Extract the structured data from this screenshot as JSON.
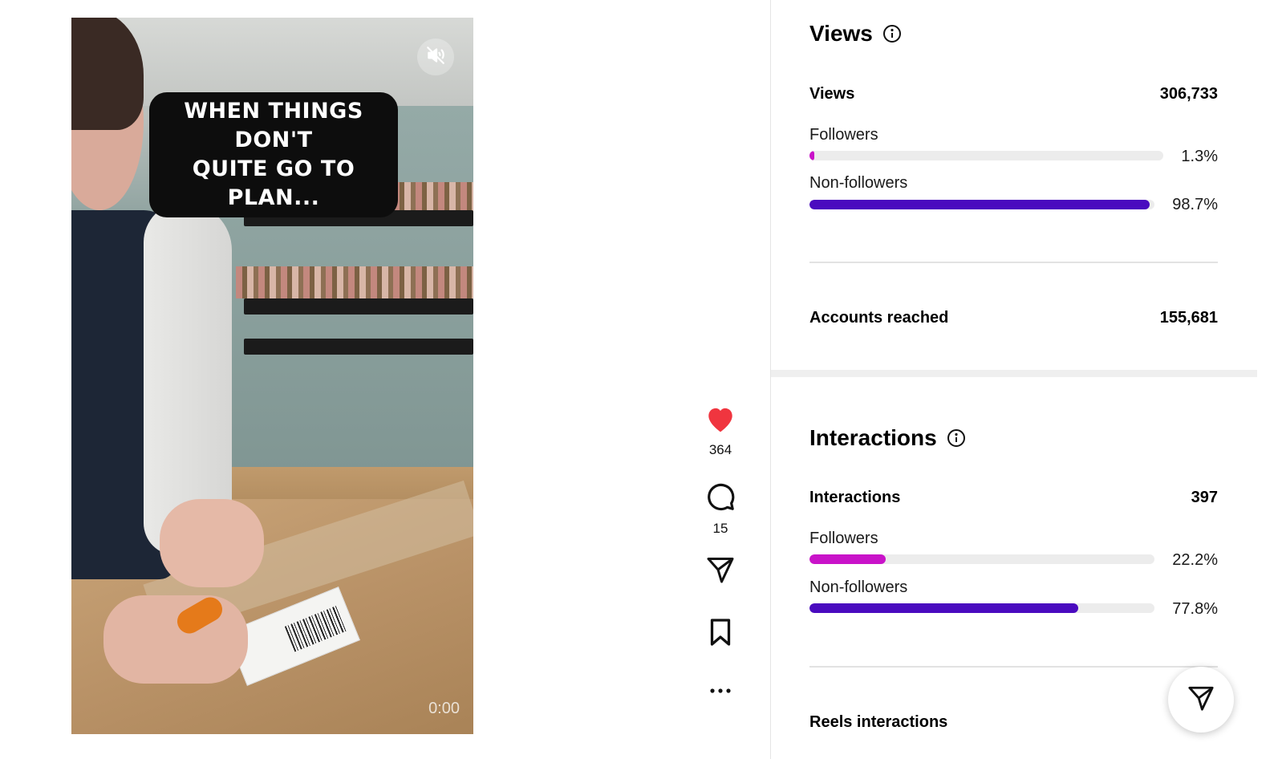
{
  "video": {
    "caption": "WHEN THINGS DON'T\nQUITE GO TO PLAN...",
    "time": "0:00",
    "mute_icon": "speaker-muted-icon"
  },
  "actions": {
    "like_count": "364",
    "comment_count": "15",
    "like_color": "#f0353f"
  },
  "views_section": {
    "title": "Views",
    "total_label": "Views",
    "total_value": "306,733",
    "followers_label": "Followers",
    "followers_pct": "1.3%",
    "followers_fraction": 0.013,
    "nonfollowers_label": "Non-followers",
    "nonfollowers_pct": "98.7%",
    "nonfollowers_fraction": 0.987,
    "accounts_reached_label": "Accounts reached",
    "accounts_reached_value": "155,681"
  },
  "interactions_section": {
    "title": "Interactions",
    "total_label": "Interactions",
    "total_value": "397",
    "followers_label": "Followers",
    "followers_pct": "22.2%",
    "followers_fraction": 0.222,
    "nonfollowers_label": "Non-followers",
    "nonfollowers_pct": "77.8%",
    "nonfollowers_fraction": 0.778,
    "reels_label": "Reels interactions"
  },
  "colors": {
    "followers": "#c913c9",
    "nonfollowers": "#4a0bbf",
    "track": "#ececec"
  }
}
